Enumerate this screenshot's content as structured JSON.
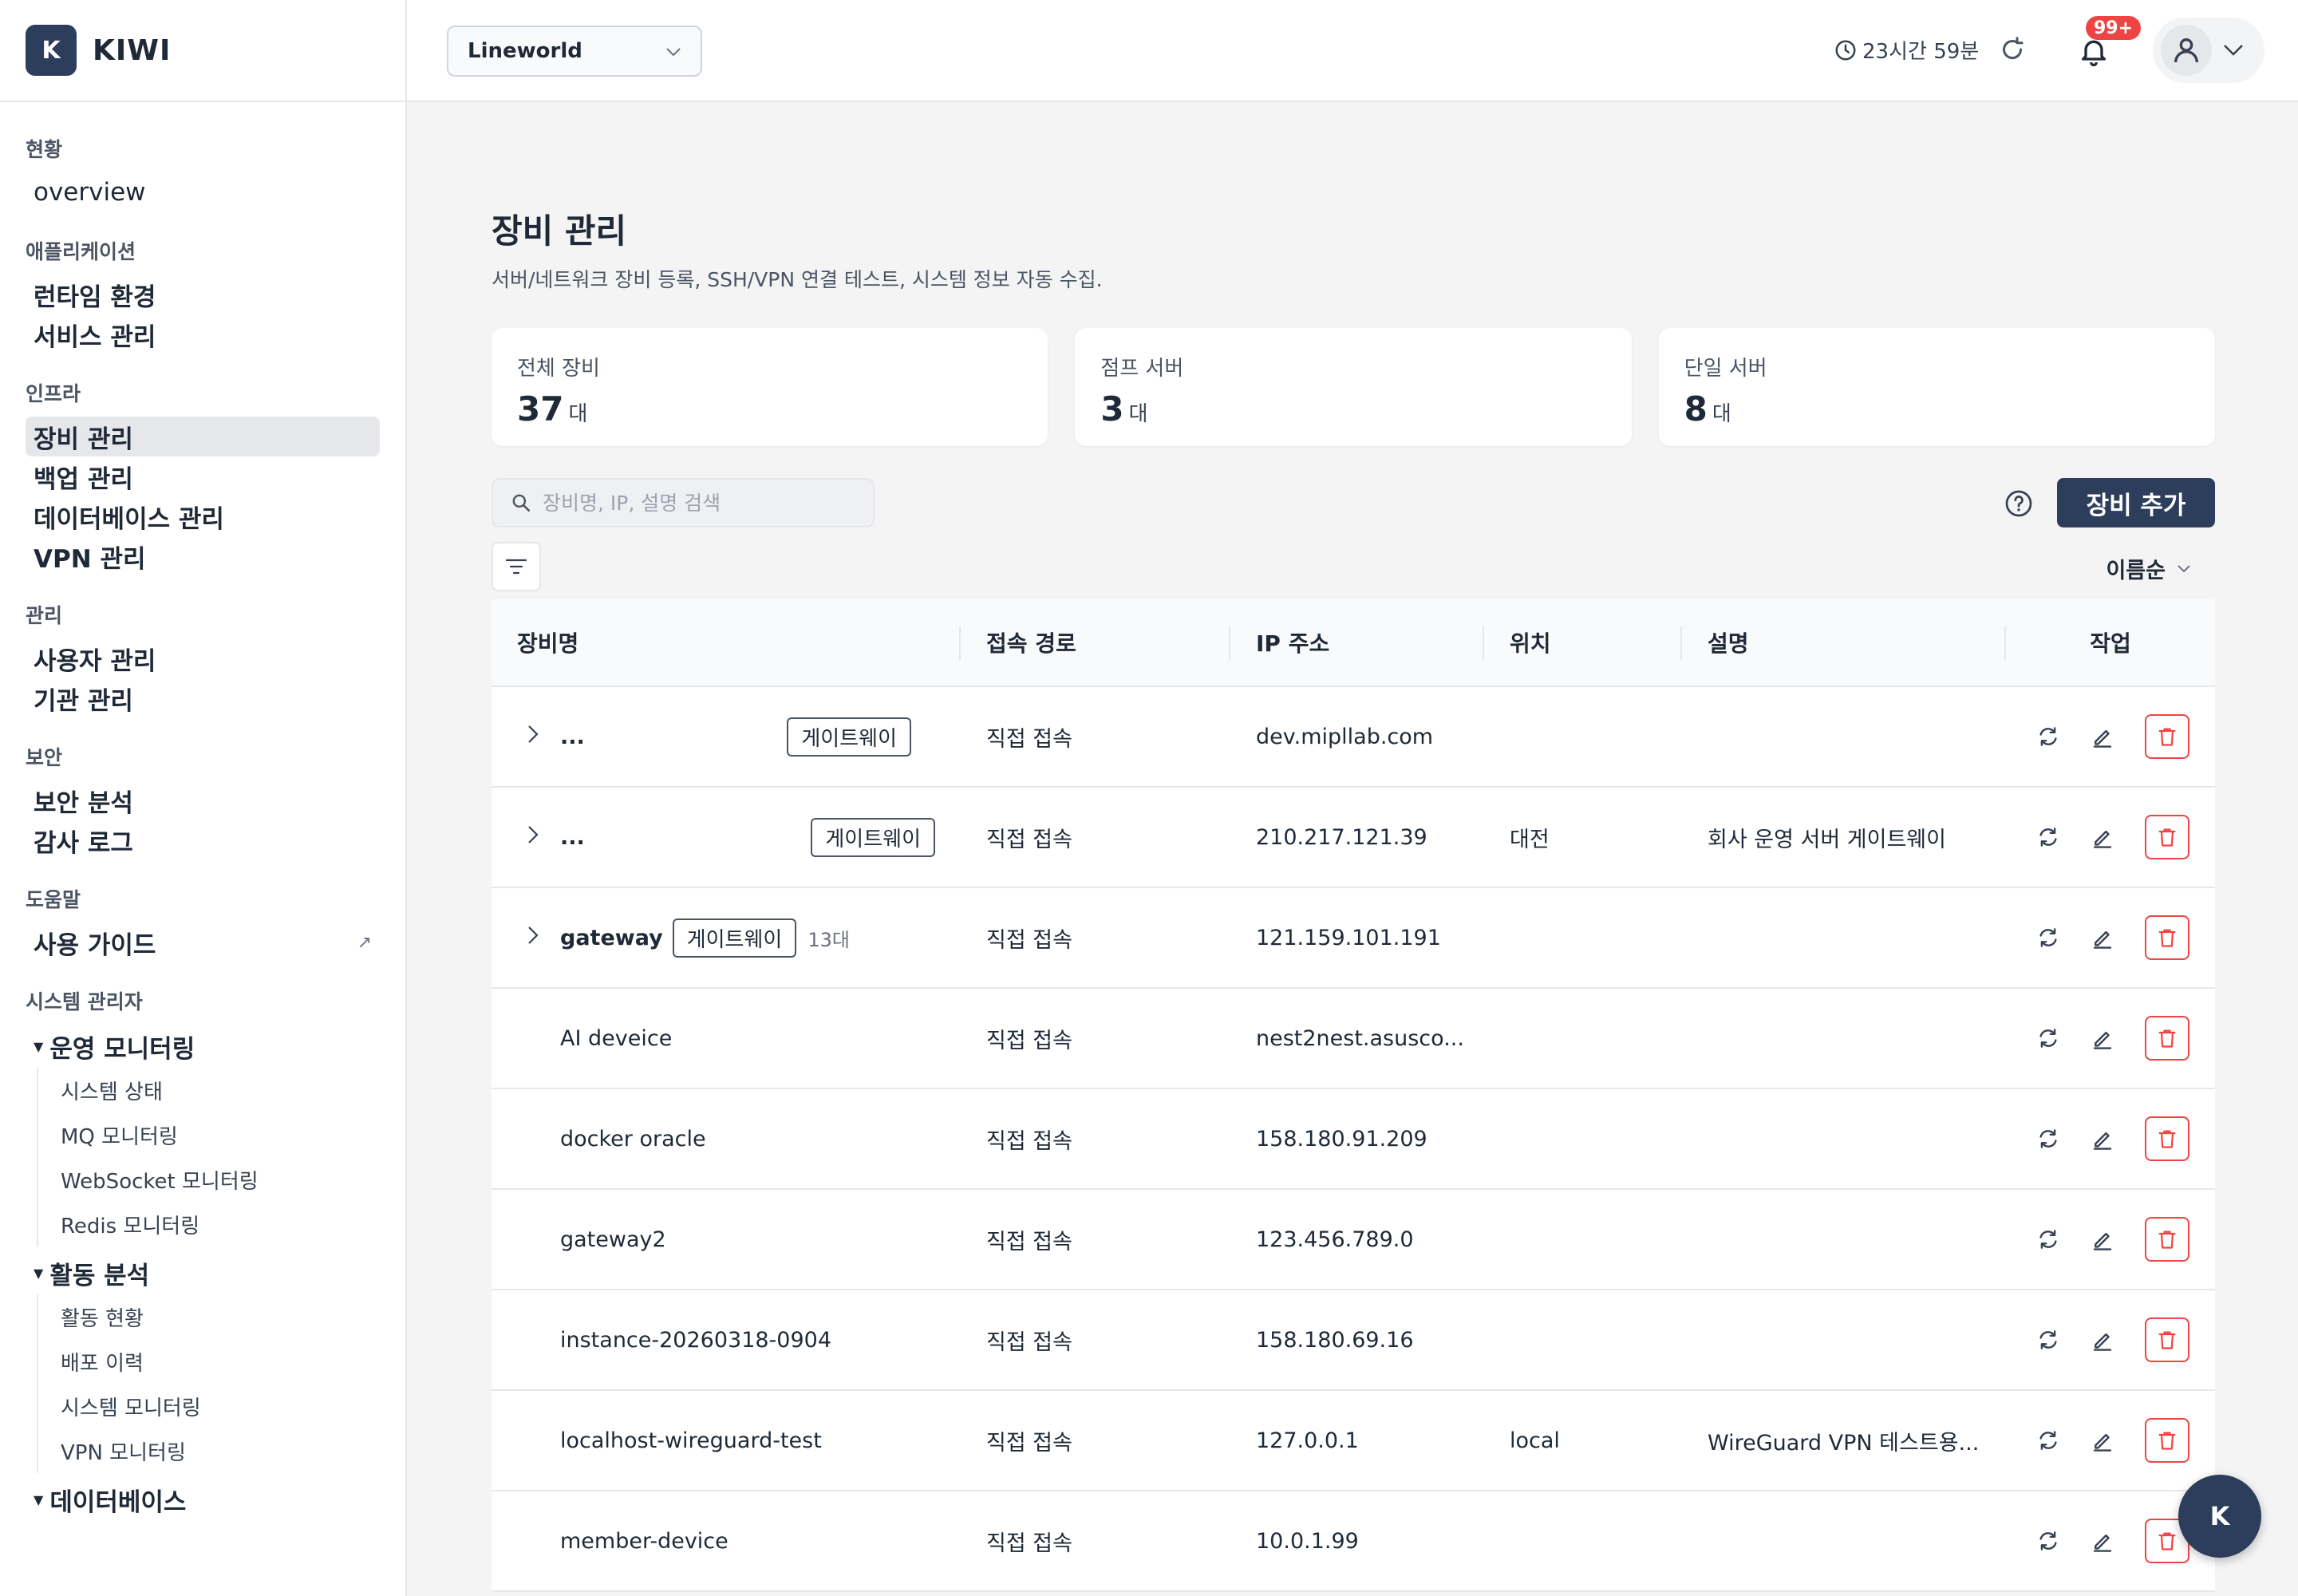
{
  "brand": {
    "logo_letter": "K",
    "name": "KIWI"
  },
  "sidebar": {
    "groups": [
      {
        "label": "현황",
        "items": [
          {
            "label": "overview"
          }
        ]
      },
      {
        "label": "애플리케이션",
        "items": [
          {
            "label": "런타임 환경"
          },
          {
            "label": "서비스 관리"
          }
        ]
      },
      {
        "label": "인프라",
        "items": [
          {
            "label": "장비 관리",
            "active": true
          },
          {
            "label": "백업 관리"
          },
          {
            "label": "데이터베이스 관리"
          },
          {
            "label": "VPN 관리"
          }
        ]
      },
      {
        "label": "관리",
        "items": [
          {
            "label": "사용자 관리"
          },
          {
            "label": "기관 관리"
          }
        ]
      },
      {
        "label": "보안",
        "items": [
          {
            "label": "보안 분석"
          },
          {
            "label": "감사 로그"
          }
        ]
      },
      {
        "label": "도움말",
        "items": [
          {
            "label": "사용 가이드",
            "external_icon": "↗"
          }
        ]
      }
    ],
    "admin": {
      "label": "시스템 관리자",
      "sections": [
        {
          "label": "운영 모니터링",
          "items": [
            "시스템 상태",
            "MQ 모니터링",
            "WebSocket 모니터링",
            "Redis 모니터링"
          ]
        },
        {
          "label": "활동 분석",
          "items": [
            "활동 현황",
            "배포 이력",
            "시스템 모니터링",
            "VPN 모니터링"
          ]
        },
        {
          "label": "데이터베이스",
          "items": []
        }
      ]
    }
  },
  "header": {
    "org_select": "Lineworld",
    "session_time": "23시간 59분",
    "notification_badge": "99+"
  },
  "page": {
    "title": "장비 관리",
    "subtitle": "서버/네트워크 장비 등록, SSH/VPN 연결 테스트, 시스템 정보 자동 수집."
  },
  "stats": [
    {
      "label": "전체 장비",
      "value": "37",
      "unit": "대"
    },
    {
      "label": "점프 서버",
      "value": "3",
      "unit": "대"
    },
    {
      "label": "단일 서버",
      "value": "8",
      "unit": "대"
    }
  ],
  "toolbar": {
    "search_placeholder": "장비명, IP, 설명 검색",
    "add_button": "장비 추가",
    "sort_label": "이름순"
  },
  "table": {
    "columns": [
      "장비명",
      "접속 경로",
      "IP 주소",
      "위치",
      "설명",
      "작업"
    ],
    "gateway_tag": "게이트웨이",
    "rows": [
      {
        "name": "...",
        "expandable": true,
        "gateway": true,
        "count": "",
        "route": "직접 접속",
        "ip": "dev.mipllab.com",
        "location": "",
        "description": ""
      },
      {
        "name": "...",
        "expandable": true,
        "gateway": true,
        "count": "",
        "route": "직접 접속",
        "ip": "210.217.121.39",
        "location": "대전",
        "description": "회사 운영 서버 게이트웨이"
      },
      {
        "name": "gateway",
        "expandable": true,
        "gateway": true,
        "count": "13대",
        "route": "직접 접속",
        "ip": "121.159.101.191",
        "location": "",
        "description": ""
      },
      {
        "name": "AI deveice",
        "expandable": false,
        "gateway": false,
        "count": "",
        "route": "직접 접속",
        "ip": "nest2nest.asusco...",
        "location": "",
        "description": ""
      },
      {
        "name": "docker oracle",
        "expandable": false,
        "gateway": false,
        "count": "",
        "route": "직접 접속",
        "ip": "158.180.91.209",
        "location": "",
        "description": ""
      },
      {
        "name": "gateway2",
        "expandable": false,
        "gateway": false,
        "count": "",
        "route": "직접 접속",
        "ip": "123.456.789.0",
        "location": "",
        "description": ""
      },
      {
        "name": "instance-20260318-0904",
        "expandable": false,
        "gateway": false,
        "count": "",
        "route": "직접 접속",
        "ip": "158.180.69.16",
        "location": "",
        "description": ""
      },
      {
        "name": "localhost-wireguard-test",
        "expandable": false,
        "gateway": false,
        "count": "",
        "route": "직접 접속",
        "ip": "127.0.0.1",
        "location": "local",
        "description": "WireGuard VPN 테스트용..."
      },
      {
        "name": "member-device",
        "expandable": false,
        "gateway": false,
        "count": "",
        "route": "직접 접속",
        "ip": "10.0.1.99",
        "location": "",
        "description": ""
      }
    ]
  },
  "fab": {
    "label": "K"
  },
  "colors": {
    "brand": "#2c3e5c",
    "danger": "#ef4444",
    "active_bg": "#e5e7eb"
  }
}
